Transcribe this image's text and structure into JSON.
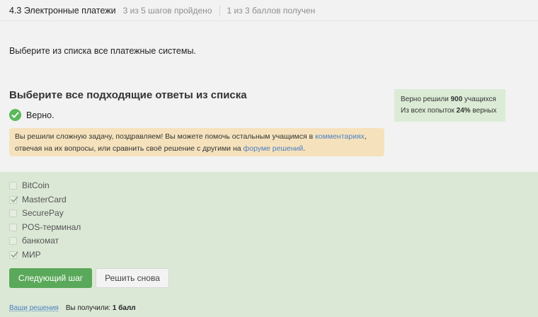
{
  "header": {
    "lesson": "4.3 Электронные платежи",
    "progress": "3 из 5 шагов пройдено",
    "points": "1 из 3 баллов  получен"
  },
  "question": "Выберите из списка все платежные системы.",
  "heading": "Выберите все подходящие ответы из списка",
  "verdict": "Верно.",
  "notice": {
    "text1": "Вы решили сложную задачу, поздравляем! Вы можете помочь остальным учащимся в ",
    "link1": "комментариях",
    "text2": ", отвечая на их вопросы, или сравнить своё решение с другими на ",
    "link2": "форуме решений",
    "text3": "."
  },
  "stats": {
    "line1_prefix": "Верно решили ",
    "solved_count": "900",
    "line1_suffix": " учащихся",
    "line2_prefix": "Из всех попыток ",
    "percent": "24%",
    "line2_suffix": " верных"
  },
  "options": [
    {
      "label": "BitCoin",
      "checked": false
    },
    {
      "label": "MasterCard",
      "checked": true
    },
    {
      "label": "SecurePay",
      "checked": false
    },
    {
      "label": "POS-терминал",
      "checked": false
    },
    {
      "label": "банкомат",
      "checked": false
    },
    {
      "label": "МИР",
      "checked": true
    }
  ],
  "buttons": {
    "next": "Следующий шаг",
    "retry": "Решить снова"
  },
  "footer": {
    "your_solutions": "Вы­ши решения",
    "score_prefix": "Вы получили: ",
    "score_value": "1 балл"
  },
  "colors": {
    "success": "#5cb85c",
    "answers_bg": "#dbe8d6",
    "notice_bg": "#f5e2bd",
    "link": "#4a7fc1"
  }
}
